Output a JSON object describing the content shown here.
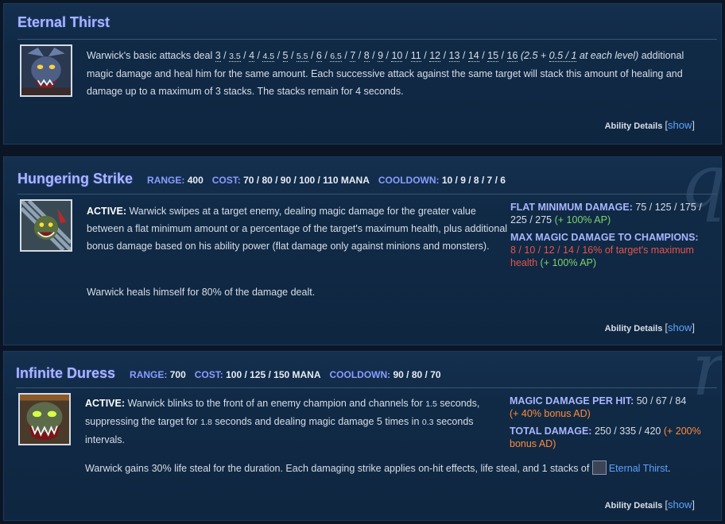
{
  "colors": {
    "title": "#a9b6ff",
    "stat_label": "#8a9cff",
    "link": "#5ea3ff",
    "ap_ratio": "#7cd46b",
    "red_value": "#e6544a",
    "ad_ratio": "#ff8a3c"
  },
  "eternal": {
    "title": "Eternal Thirst",
    "icon": "warwick-eternal-thirst-icon",
    "text_pre": "Warwick's basic attacks deal ",
    "values": [
      "3",
      "3.5",
      "4",
      "4.5",
      "5",
      "5.5",
      "6",
      "6.5",
      "7",
      "8",
      "9",
      "10",
      "11",
      "12",
      "13",
      "14",
      "15",
      "16"
    ],
    "sep": " / ",
    "paren_open": " (2.5 + ",
    "paren_mid": "0.5 / 1",
    "paren_close": " at each level)",
    "text_post": " additional magic damage and heal him for the same amount. Each successive attack against the same target will stack this amount of healing and damage up to a maximum of 3 stacks. The stacks remain for 4 seconds.",
    "details_label": "Ability Details",
    "bracket_open": "[",
    "show": "show",
    "bracket_close": "]"
  },
  "hungering": {
    "title": "Hungering Strike",
    "watermark": "q",
    "icon": "warwick-hungering-strike-icon",
    "stats": [
      {
        "label": "RANGE:",
        "value": "400"
      },
      {
        "label": "COST:",
        "value": "70 / 80 / 90 / 100 / 110 MANA"
      },
      {
        "label": "COOLDOWN:",
        "value": "10 / 9 / 8 / 7 / 6"
      }
    ],
    "active_label": "ACTIVE:",
    "active_text": " Warwick swipes at a target enemy, dealing magic damage for the greater value between a flat minimum amount or a percentage of the target's maximum health, plus additional bonus damage based on his ability power (flat damage only against minions and monsters).",
    "heal_text": "Warwick heals himself for 80% of the damage dealt.",
    "flat_label": "FLAT MINIMUM DAMAGE:",
    "flat_value": " 75 / 125 / 175 / 225 / 275",
    "flat_ratio": " (+ 100% AP)",
    "max_label": "MAX MAGIC DAMAGE TO CHAMPIONS:",
    "max_value": " 8 / 10 / 12 / 14 / 16% of target's maximum health",
    "max_ratio": " (+ 100% AP)",
    "details_label": "Ability Details",
    "bracket_open": "[",
    "show": "show",
    "bracket_close": "]"
  },
  "infinite": {
    "title": "Infinite Duress",
    "watermark": "r",
    "icon": "warwick-infinite-duress-icon",
    "stats": [
      {
        "label": "RANGE:",
        "value": "700"
      },
      {
        "label": "COST:",
        "value": "100 / 125 / 150 MANA"
      },
      {
        "label": "COOLDOWN:",
        "value": "90 / 80 / 70"
      }
    ],
    "active_label": "ACTIVE:",
    "active_a": " Warwick blinks to the front of an enemy champion and channels for ",
    "channel_time": "1.5",
    "active_b": " seconds, suppressing the target for ",
    "suppress_time": "1.8",
    "active_c": " seconds and dealing magic damage 5 times in ",
    "interval_time": "0.3",
    "active_d": " seconds intervals.",
    "lifesteal_text": "Warwick gains 30% life steal for the duration. Each damaging strike applies on-hit effects, life steal, and 1 stacks of ",
    "lifesteal_link": "Eternal Thirst",
    "lifesteal_end": ".",
    "per_hit_label": "MAGIC DAMAGE PER HIT:",
    "per_hit_value": " 50 / 67 / 84",
    "per_hit_ratio": "(+ 40% bonus AD)",
    "total_label": "TOTAL DAMAGE:",
    "total_value": " 250 / 335 / 420",
    "total_ratio": " (+ 200% bonus AD)",
    "details_label": "Ability Details",
    "bracket_open": "[",
    "show": "show",
    "bracket_close": "]"
  }
}
